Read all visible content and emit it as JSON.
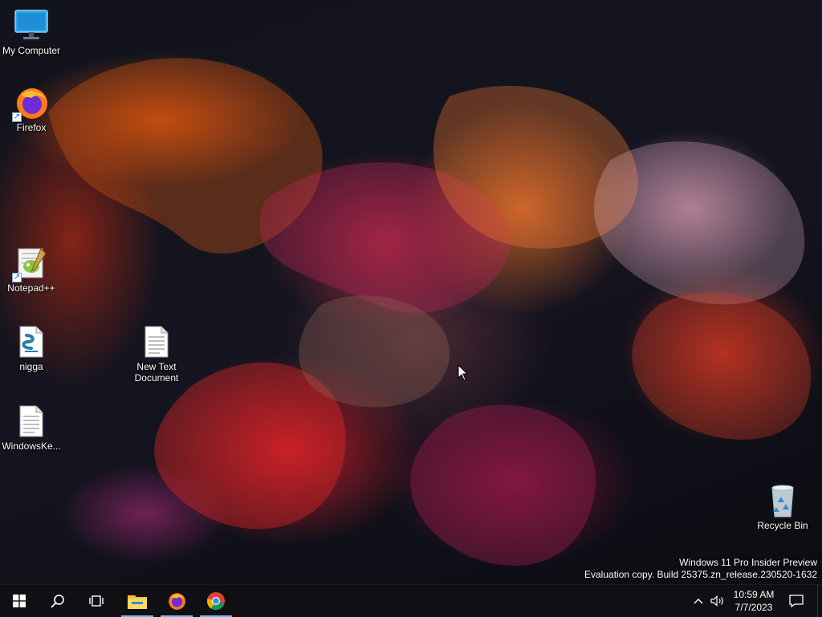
{
  "desktop": {
    "icons": {
      "my_computer": "My Computer",
      "firefox": "Firefox",
      "notepadpp": "Notepad++",
      "nigga": "nigga",
      "windowskey": "WindowsKe...",
      "new_text_doc_line1": "New Text",
      "new_text_doc_line2": "Document",
      "recycle_bin": "Recycle Bin"
    },
    "watermark": {
      "line1": "Windows 11 Pro Insider Preview",
      "line2": "Evaluation copy. Build 25375.zn_release.230520-1632"
    }
  },
  "taskbar": {
    "buttons": [
      "windows-start-icon",
      "search-icon",
      "task-view-icon",
      "file-explorer-icon",
      "firefox-icon",
      "chrome-icon"
    ],
    "tray": {
      "time": "10:59 AM",
      "date": "7/7/2023"
    }
  },
  "colors": {
    "taskbar_bg": "#101014",
    "accent": "#76b9ed",
    "text": "#ffffff"
  }
}
